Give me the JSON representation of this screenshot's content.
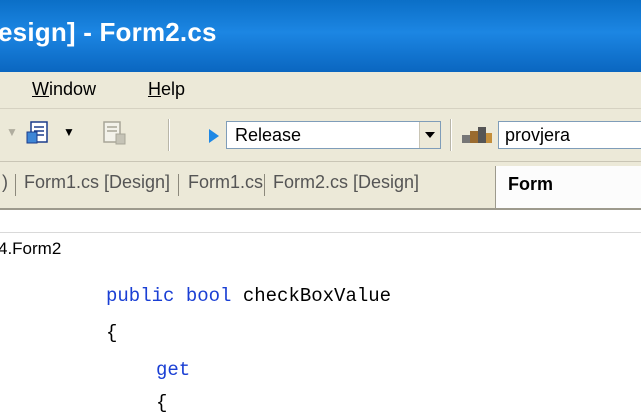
{
  "window": {
    "title": "esign] - Form2.cs"
  },
  "menu": {
    "items": [
      {
        "underline": "W",
        "rest": "indow"
      },
      {
        "underline": "H",
        "rest": "elp"
      }
    ]
  },
  "toolbar": {
    "config_combo": {
      "value": "Release"
    },
    "project_combo": {
      "value": "provjera"
    }
  },
  "tabs": {
    "partial_left": ")",
    "items": [
      "Form1.cs [Design]",
      "Form1.cs",
      "Form2.cs [Design]"
    ],
    "active": "Form"
  },
  "class_bar": {
    "text": "4.Form2"
  },
  "code": {
    "line1": {
      "kw1": "public",
      "kw2": "bool",
      "ident": "checkBoxValue"
    },
    "line2": "{",
    "line3": {
      "kw": "get"
    },
    "line4": "{"
  },
  "colors": {
    "title_bar": "#1c86e3",
    "keyword": "#1a3fd4",
    "chrome": "#ece9d8"
  },
  "icons": [
    "dropdown-arrow-icon",
    "document-icon",
    "document-disabled-icon",
    "play-icon",
    "combo-arrow-icon",
    "project-icon"
  ]
}
